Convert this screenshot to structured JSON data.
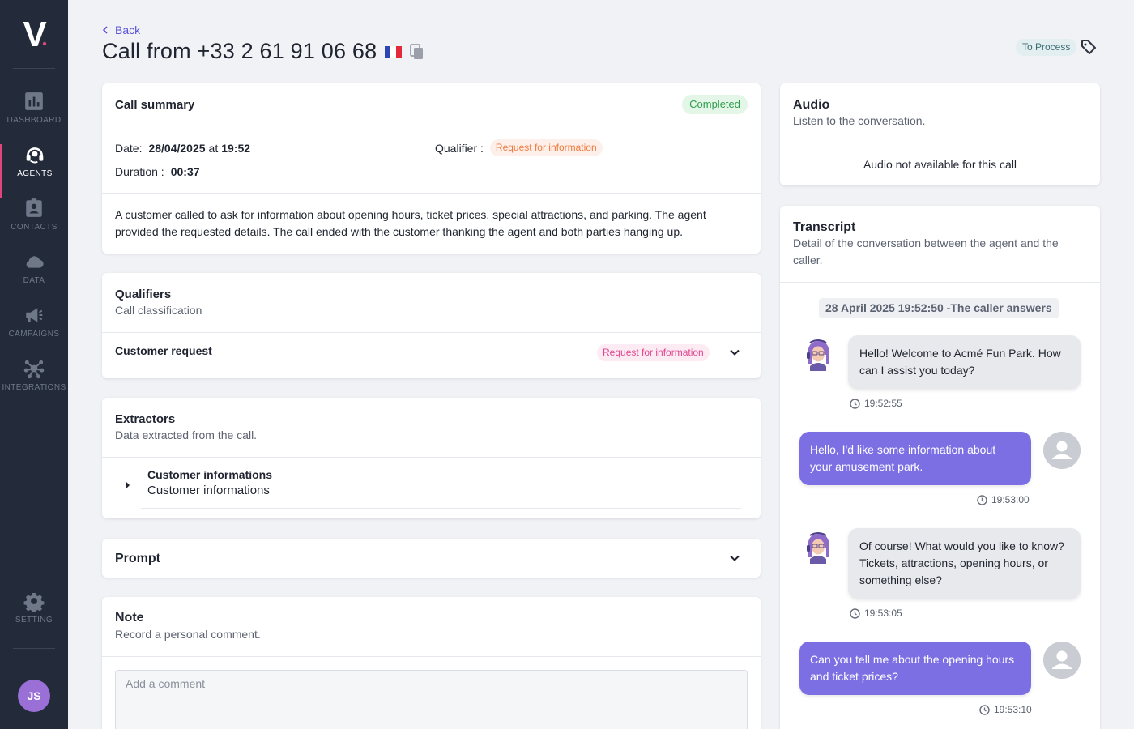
{
  "sidebar": {
    "logo": "V",
    "items": [
      {
        "label": "DASHBOARD",
        "icon": "chart-icon",
        "active": false
      },
      {
        "label": "AGENTS",
        "icon": "headset-icon",
        "active": true
      },
      {
        "label": "CONTACTS",
        "icon": "contact-card-icon",
        "active": false
      },
      {
        "label": "DATA",
        "icon": "cloud-icon",
        "active": false
      },
      {
        "label": "CAMPAIGNS",
        "icon": "megaphone-icon",
        "active": false
      },
      {
        "label": "INTEGRATIONS",
        "icon": "network-icon",
        "active": false
      }
    ],
    "setting": {
      "label": "SETTING",
      "icon": "gear-icon"
    },
    "user_initials": "JS"
  },
  "header": {
    "back_label": "Back",
    "title": "Call from +33 2 61 91 06 68",
    "status": "To Process"
  },
  "call_summary": {
    "title": "Call summary",
    "status": "Completed",
    "date_label": "Date:",
    "date_value": "28/04/2025",
    "date_at": "at",
    "time_value": "19:52",
    "duration_label": "Duration :",
    "duration_value": "00:37",
    "qualifier_label": "Qualifier :",
    "qualifier_value": "Request for information",
    "summary": "A customer called to ask for information about opening hours, ticket prices, special attractions, and parking. The agent provided the requested details. The call ended with the customer thanking the agent and both parties hanging up."
  },
  "qualifiers": {
    "title": "Qualifiers",
    "subtitle": "Call classification",
    "row_label": "Customer request",
    "row_value": "Request for information"
  },
  "extractors": {
    "title": "Extractors",
    "subtitle": "Data extracted from the call.",
    "item_title": "Customer informations",
    "item_sub": "Customer informations"
  },
  "prompt": {
    "title": "Prompt"
  },
  "note": {
    "title": "Note",
    "subtitle": "Record a personal comment.",
    "placeholder": "Add a comment"
  },
  "audio": {
    "title": "Audio",
    "subtitle": "Listen to the conversation.",
    "message": "Audio not available for this call"
  },
  "transcript": {
    "title": "Transcript",
    "subtitle": "Detail of the conversation between the agent and the caller.",
    "date_chip": "28 April 2025 19:52:50 -The caller answers",
    "messages": [
      {
        "role": "agent",
        "text": "Hello! Welcome to Acmé Fun Park. How can I assist you today?",
        "time": "19:52:55"
      },
      {
        "role": "user",
        "text": "Hello, I'd like some information about your amusement park.",
        "time": "19:53:00"
      },
      {
        "role": "agent",
        "text": "Of course! What would you like to know? Tickets, attractions, opening hours, or something else?",
        "time": "19:53:05"
      },
      {
        "role": "user",
        "text": "Can you tell me about the opening hours and ticket prices?",
        "time": "19:53:10"
      }
    ]
  },
  "colors": {
    "sidebar_bg": "#232b3b",
    "accent": "#5b54d6",
    "user_bubble": "#7b6fe3",
    "active_marker": "#e0457b"
  }
}
